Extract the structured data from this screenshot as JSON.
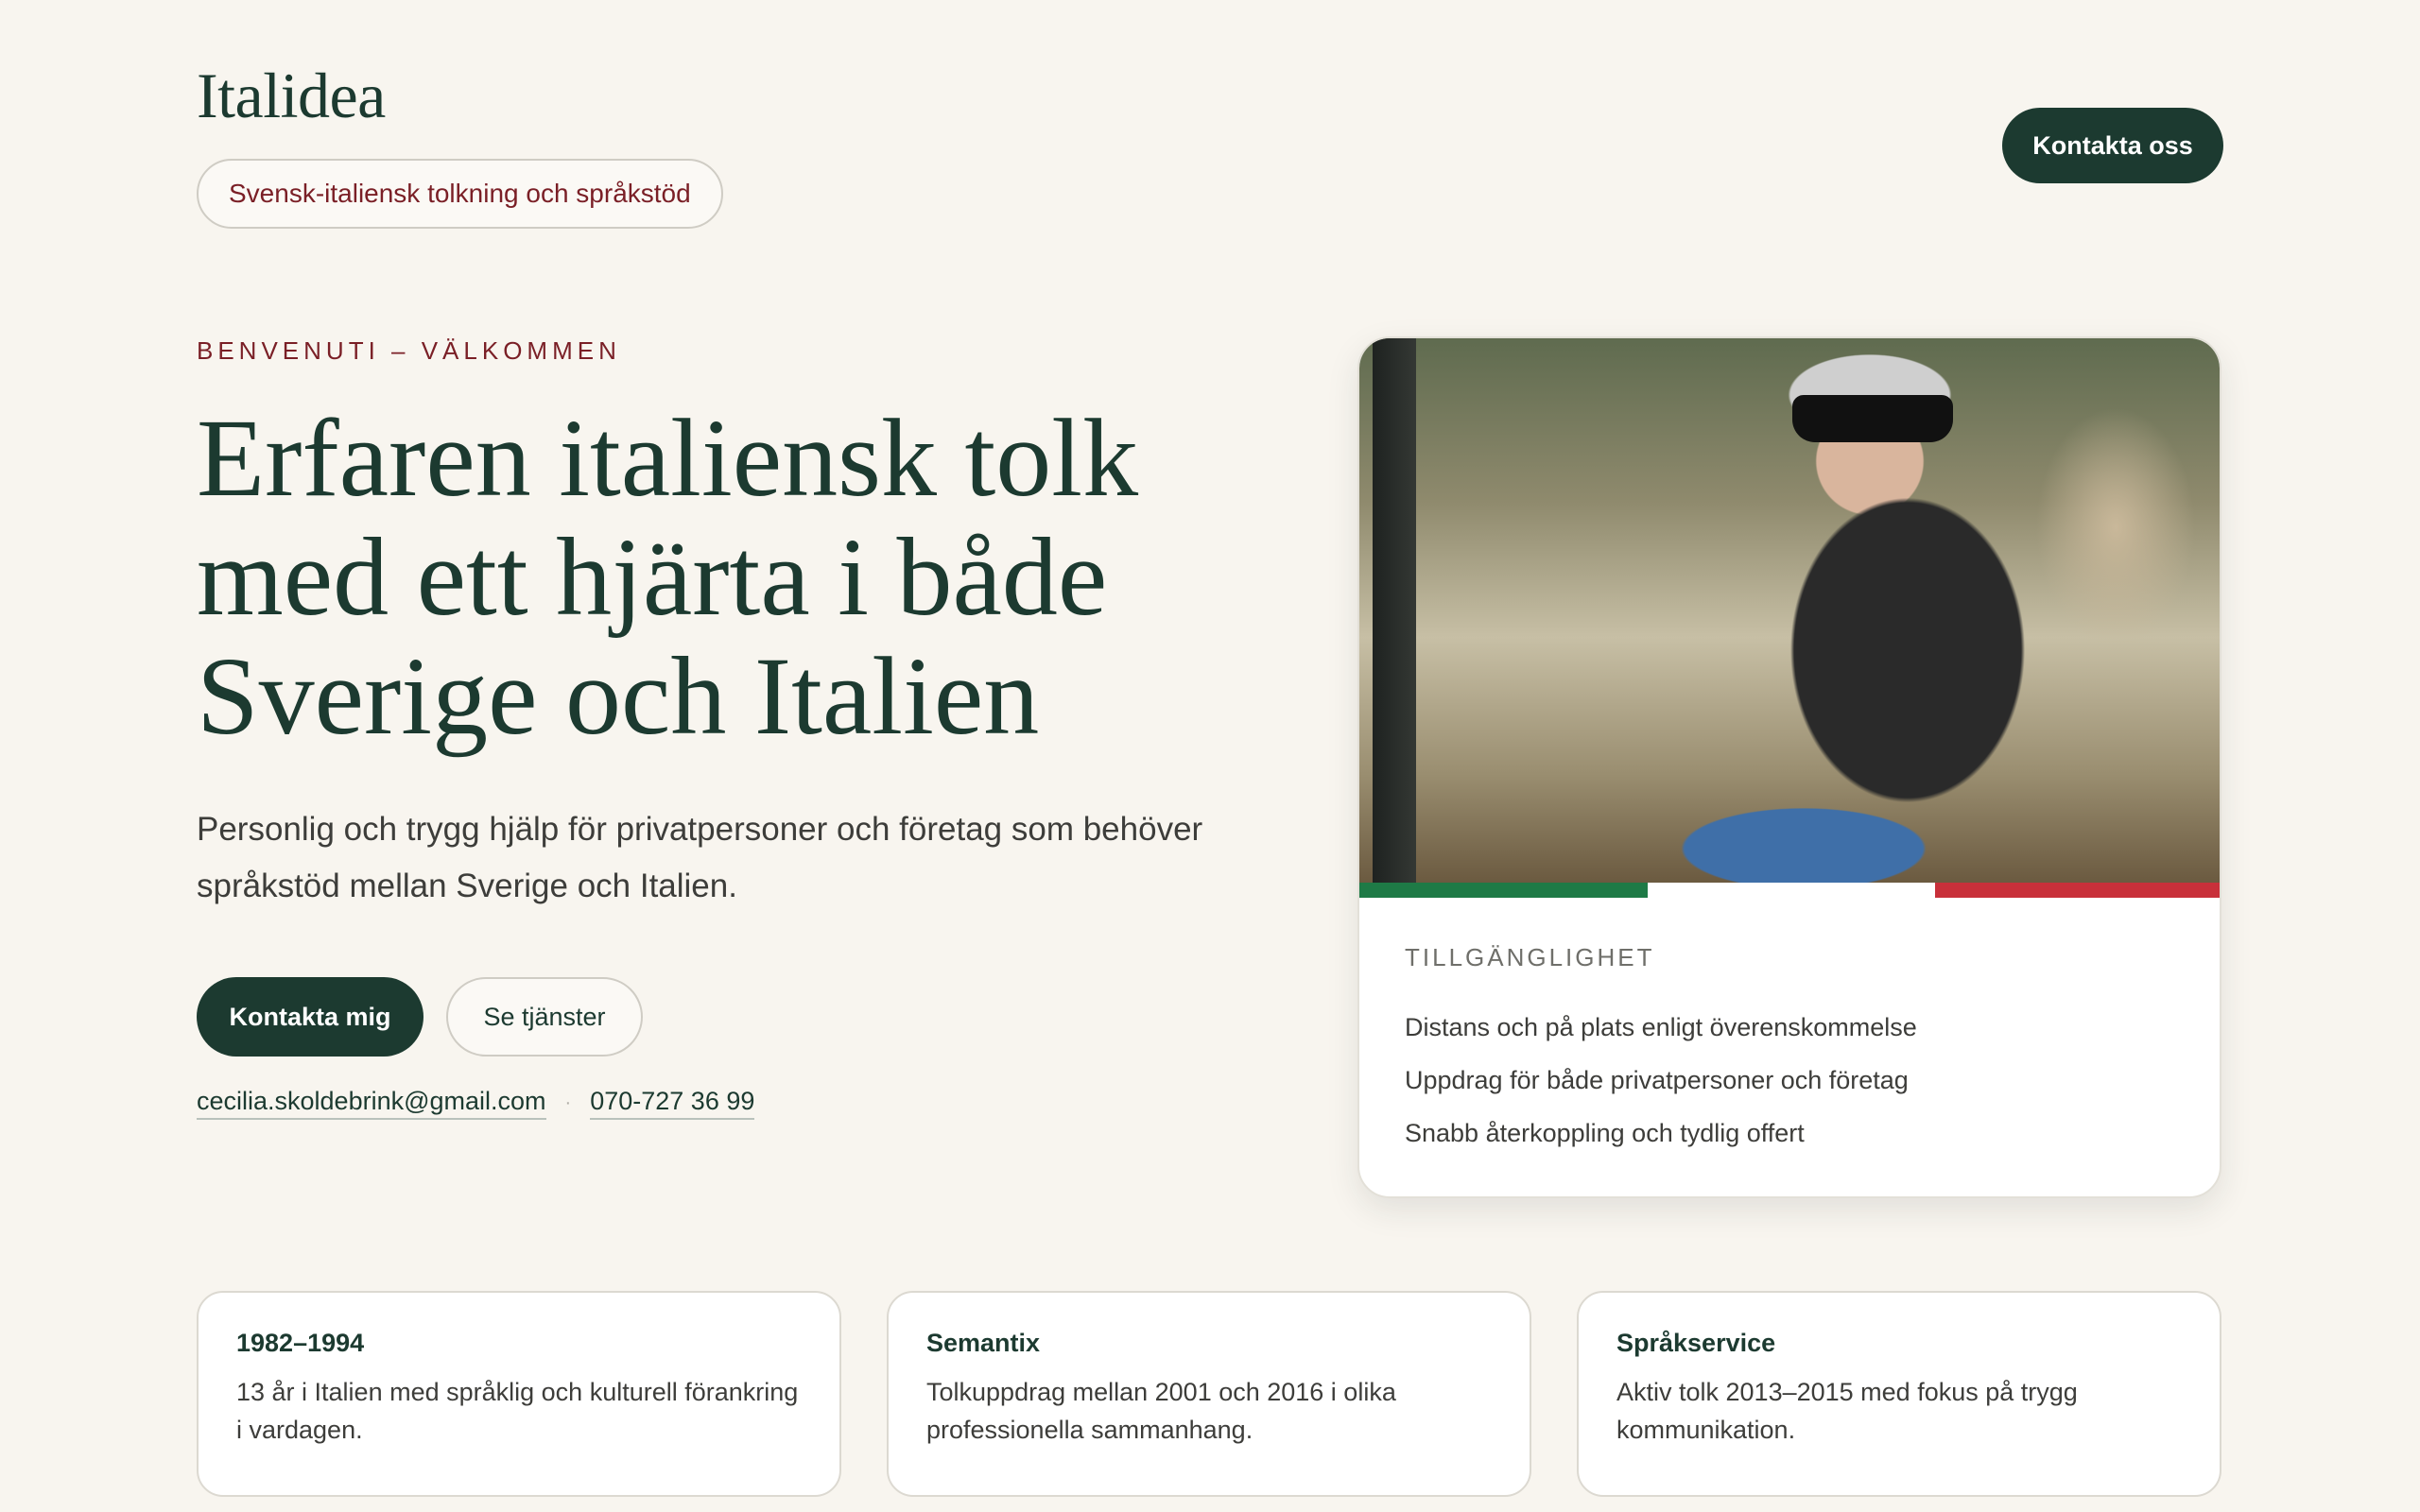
{
  "header": {
    "brand": "Italidea",
    "tagline": "Svensk-italiensk tolkning och språkstöd",
    "cta_label": "Kontakta oss"
  },
  "hero": {
    "eyebrow": "BENVENUTI – VÄLKOMMEN",
    "title": "Erfaren italiensk tolk med ett hjärta i både Sverige och Italien",
    "lead": "Personlig och trygg hjälp för privatpersoner och företag som behöver språkstöd mellan Sverige och Italien.",
    "primary_button": "Kontakta mig",
    "secondary_button": "Se tjänster",
    "email": "cecilia.skoldebrink@gmail.com",
    "separator": "·",
    "phone": "070-727 36 99"
  },
  "availability_card": {
    "label": "TILLGÄNGLIGHET",
    "items": [
      "Distans och på plats enligt överenskommelse",
      "Uppdrag för både privatpersoner och företag",
      "Snabb återkoppling och tydlig offert"
    ]
  },
  "info_cards": [
    {
      "title": "1982–1994",
      "text": "13 år i Italien med språklig och kulturell förankring i vardagen."
    },
    {
      "title": "Semantix",
      "text": "Tolkuppdrag mellan 2001 och 2016 i olika professionella sammanhang."
    },
    {
      "title": "Språkservice",
      "text": "Aktiv tolk 2013–2015 med fokus på trygg kommunikation."
    }
  ],
  "colors": {
    "primary": "#1c3a30",
    "accent": "#7a1f26",
    "background": "#f8f5ef",
    "flag_green": "#1e7a46",
    "flag_white": "#ffffff",
    "flag_red": "#c8303a"
  }
}
